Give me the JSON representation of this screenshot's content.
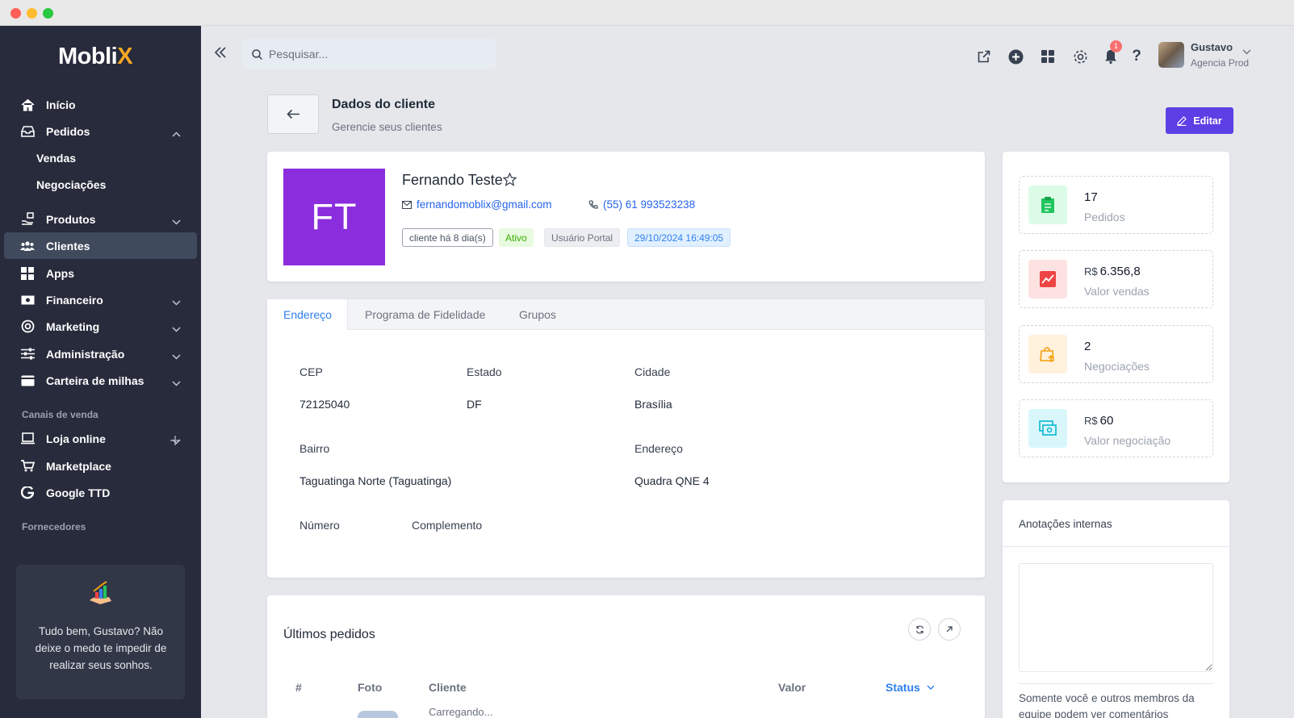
{
  "app": {
    "logo_main": "Mobli",
    "logo_accent": "X"
  },
  "sidebar": {
    "items": [
      {
        "label": "Início"
      },
      {
        "label": "Pedidos"
      },
      {
        "label": "Produtos"
      },
      {
        "label": "Clientes"
      },
      {
        "label": "Apps"
      },
      {
        "label": "Financeiro"
      },
      {
        "label": "Marketing"
      },
      {
        "label": "Administração"
      },
      {
        "label": "Carteira de milhas"
      }
    ],
    "sub_items": [
      {
        "label": "Vendas"
      },
      {
        "label": "Negociações"
      }
    ],
    "sales_channels_label": "Canais de venda",
    "channels": [
      {
        "label": "Loja online"
      },
      {
        "label": "Marketplace"
      },
      {
        "label": "Google TTD"
      }
    ],
    "suppliers_label": "Fornecedores",
    "promo_text": "Tudo bem, Gustavo? Não deixe o medo te impedir de realizar seus sonhos."
  },
  "header": {
    "search_placeholder": "Pesquisar...",
    "notification_count": "1",
    "user_name": "Gustavo",
    "user_org": "Agencia Prod"
  },
  "page": {
    "title": "Dados do cliente",
    "subtitle": "Gerencie seus clientes",
    "edit_label": "Editar"
  },
  "client": {
    "initials": "FT",
    "name": "Fernando Teste",
    "email": "fernandomoblix@gmail.com",
    "phone": "(55) 61 993523238",
    "tags": [
      "cliente há 8 dia(s)",
      "Ativo",
      "Usuário Portal",
      "29/10/2024 16:49:05"
    ]
  },
  "tabs": [
    "Endereço",
    "Programa de Fidelidade",
    "Grupos"
  ],
  "address": {
    "cep_label": "CEP",
    "cep": "72125040",
    "estado_label": "Estado",
    "estado": "DF",
    "cidade_label": "Cidade",
    "cidade": "Brasília",
    "bairro_label": "Bairro",
    "bairro": "Taguatinga Norte (Taguatinga)",
    "endereco_label": "Endereço",
    "endereco": "Quadra QNE 4",
    "numero_label": "Número",
    "complemento_label": "Complemento"
  },
  "orders": {
    "title": "Últimos pedidos",
    "columns": [
      "#",
      "Foto",
      "Cliente",
      "Valor",
      "Status"
    ],
    "loading": "Carregando..."
  },
  "stats": [
    {
      "currency": "",
      "value": "17",
      "label": "Pedidos",
      "icon": "clipboard-icon",
      "color": "#22c55e",
      "bg": "#dcfce7"
    },
    {
      "currency": "R$",
      "value": "6.356,8",
      "label": "Valor vendas",
      "icon": "chart-icon",
      "color": "#ef4444",
      "bg": "#fde2e2"
    },
    {
      "currency": "",
      "value": "2",
      "label": "Negociações",
      "icon": "bag-icon",
      "color": "#f59e0b",
      "bg": "#fff1dc"
    },
    {
      "currency": "R$",
      "value": "60",
      "label": "Valor negociação",
      "icon": "money-icon",
      "color": "#06b6d4",
      "bg": "#d9f7fb"
    }
  ],
  "notes": {
    "title": "Anotações internas",
    "hint": "Somente você e outros membros da equipe podem ver comentários"
  },
  "colors": {
    "primary": "#5d3fe6",
    "sidebar": "#272b3b",
    "link": "#2563eb",
    "avatar": "#8b2ddd"
  }
}
